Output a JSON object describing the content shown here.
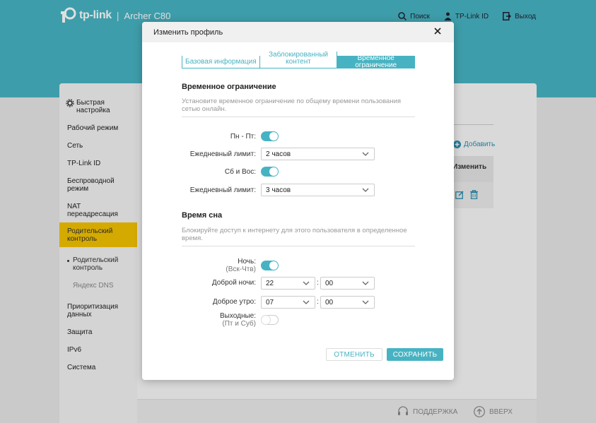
{
  "colors": {
    "accent": "#47b3c2",
    "active_nav": "#f3c200"
  },
  "header": {
    "brand": "tp-link",
    "model": "Archer C80",
    "actions": [
      {
        "label": "Поиск",
        "icon": "search-icon"
      },
      {
        "label": "TP-Link ID",
        "icon": "user-icon"
      },
      {
        "label": "Выход",
        "icon": "logout-icon"
      }
    ]
  },
  "sidebar": {
    "items": [
      {
        "label": "Быстрая настройка",
        "icon": "gear-icon"
      },
      {
        "label": "Рабочий режим"
      },
      {
        "label": "Сеть"
      },
      {
        "label": "TP-Link ID"
      },
      {
        "label": "Беспроводной режим"
      },
      {
        "label": "NAT переадресация"
      },
      {
        "label": "Родительский контроль",
        "active": true
      },
      {
        "label": "Родительский контроль",
        "sub": true,
        "selected": true
      },
      {
        "label": "Яндекс DNS",
        "sub": true
      },
      {
        "label": "Приоритизация данных"
      },
      {
        "label": "Защита"
      },
      {
        "label": "IPv6"
      },
      {
        "label": "Система"
      }
    ]
  },
  "background": {
    "add_label": "Добавить",
    "table_header": "Изменить"
  },
  "footer": {
    "support": "ПОДДЕРЖКА",
    "top": "ВВЕРХ"
  },
  "modal": {
    "title": "Изменить профиль",
    "tabs": [
      {
        "label": "Базовая информация"
      },
      {
        "label": "Заблокированный контент"
      },
      {
        "label": "Временное ограничение",
        "active": true
      }
    ],
    "time_limit": {
      "title": "Временное ограничение",
      "description": "Установите временное ограничение по общему времени пользования сетью онлайн.",
      "weekdays_label": "Пн - Пт:",
      "weekdays_enabled": true,
      "weekdays_limit_label": "Ежедневный лимит:",
      "weekdays_limit_value": "2 часов",
      "weekend_label": "Сб и Вос:",
      "weekend_enabled": true,
      "weekend_limit_label": "Ежедневный лимит:",
      "weekend_limit_value": "3 часов"
    },
    "bedtime": {
      "title": "Время сна",
      "description": "Блокируйте доступ к интернету для этого пользователя в определенное время.",
      "night_label": "Ночь:",
      "night_sub": "(Вск-Чтв)",
      "night_enabled": true,
      "goodnight_label": "Доброй ночи:",
      "goodnight_hour": "22",
      "goodnight_min": "00",
      "morning_label": "Доброе утро:",
      "morning_hour": "07",
      "morning_min": "00",
      "weekend_label": "Выходные:",
      "weekend_sub": "(Пт и Суб)",
      "weekend_enabled": false
    },
    "cancel_label": "ОТМЕНИТЬ",
    "save_label": "СОХРАНИТЬ"
  }
}
